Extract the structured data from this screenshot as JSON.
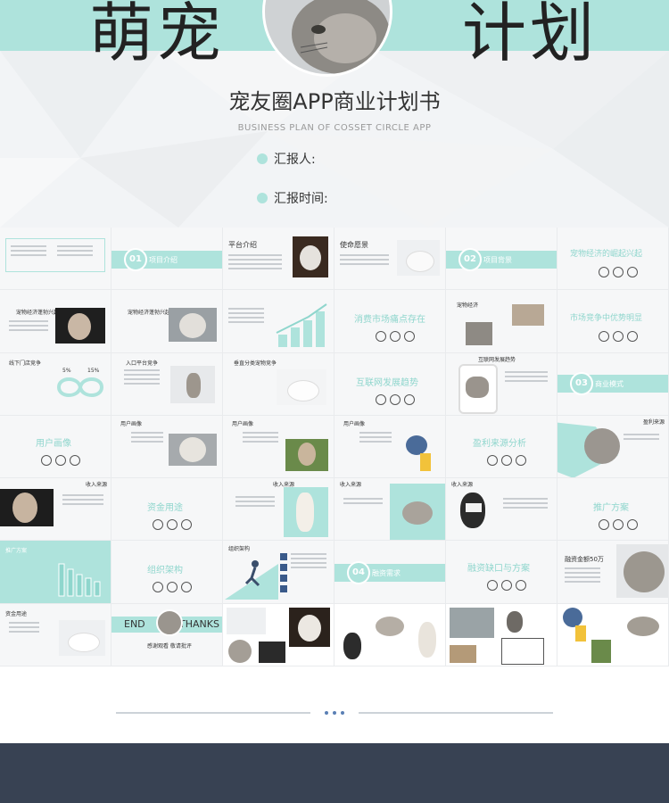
{
  "hero": {
    "big_left": "萌宠",
    "big_right": "计划",
    "title": "宠友圈APP商业计划书",
    "subtitle": "BUSINESS PLAN OF COSSET CIRCLE APP",
    "reporter_label": "汇报人:",
    "report_time_label": "汇报时间:"
  },
  "slides": {
    "s02_num": "01",
    "s02_label": "项目介绍",
    "s03_title": "平台介绍",
    "s04_title": "使命愿景",
    "s05_num": "02",
    "s05_label": "项目背景",
    "s06_title": "宠物经济的崛起兴起",
    "s07_title": "宠物经济蓬勃兴起",
    "s08_title": "宠物经济蓬勃兴起",
    "s10_title": "消费市场痛点存在",
    "s11_title": "宠物经济",
    "s12_title": "市场竞争中优势明显",
    "s13_title": "线下门店竞争",
    "s13_pct1": "5%",
    "s13_pct2": "15%",
    "s14_title": "入口平台竞争",
    "s15_title": "垂直分类宠物竞争",
    "s16_title": "互联网发展趋势",
    "s17_title": "互联网发展趋势",
    "s18_num": "03",
    "s18_label": "商业模式",
    "s19_title": "用户画像",
    "s20_title": "用户画像",
    "s21_title": "用户画像",
    "s22_title": "用户画像",
    "s23_title": "盈利来源分析",
    "s24_title": "盈利来源",
    "s25_title": "收入来源",
    "s26_title": "资金用途",
    "s27_title": "收入来源",
    "s28_title": "收入来源",
    "s29_title": "收入来源",
    "s30_title": "推广方案",
    "s31_title": "推广方案",
    "s32_title": "组织架构",
    "s33_title": "组织架构",
    "s34_num": "04",
    "s34_label": "融资需求",
    "s35_title": "融资缺口与方案",
    "s36_title": "融资金额50万",
    "s37_title": "资金用途",
    "s38_end": "END",
    "s38_thanks": "THANKS",
    "s38_sub": "感谢观看 敬请批评"
  },
  "colors": {
    "accent": "#aee3dc",
    "accent_text": "#8fd6cd",
    "footer": "#384253",
    "divider_dots": "#5a7fb5"
  }
}
